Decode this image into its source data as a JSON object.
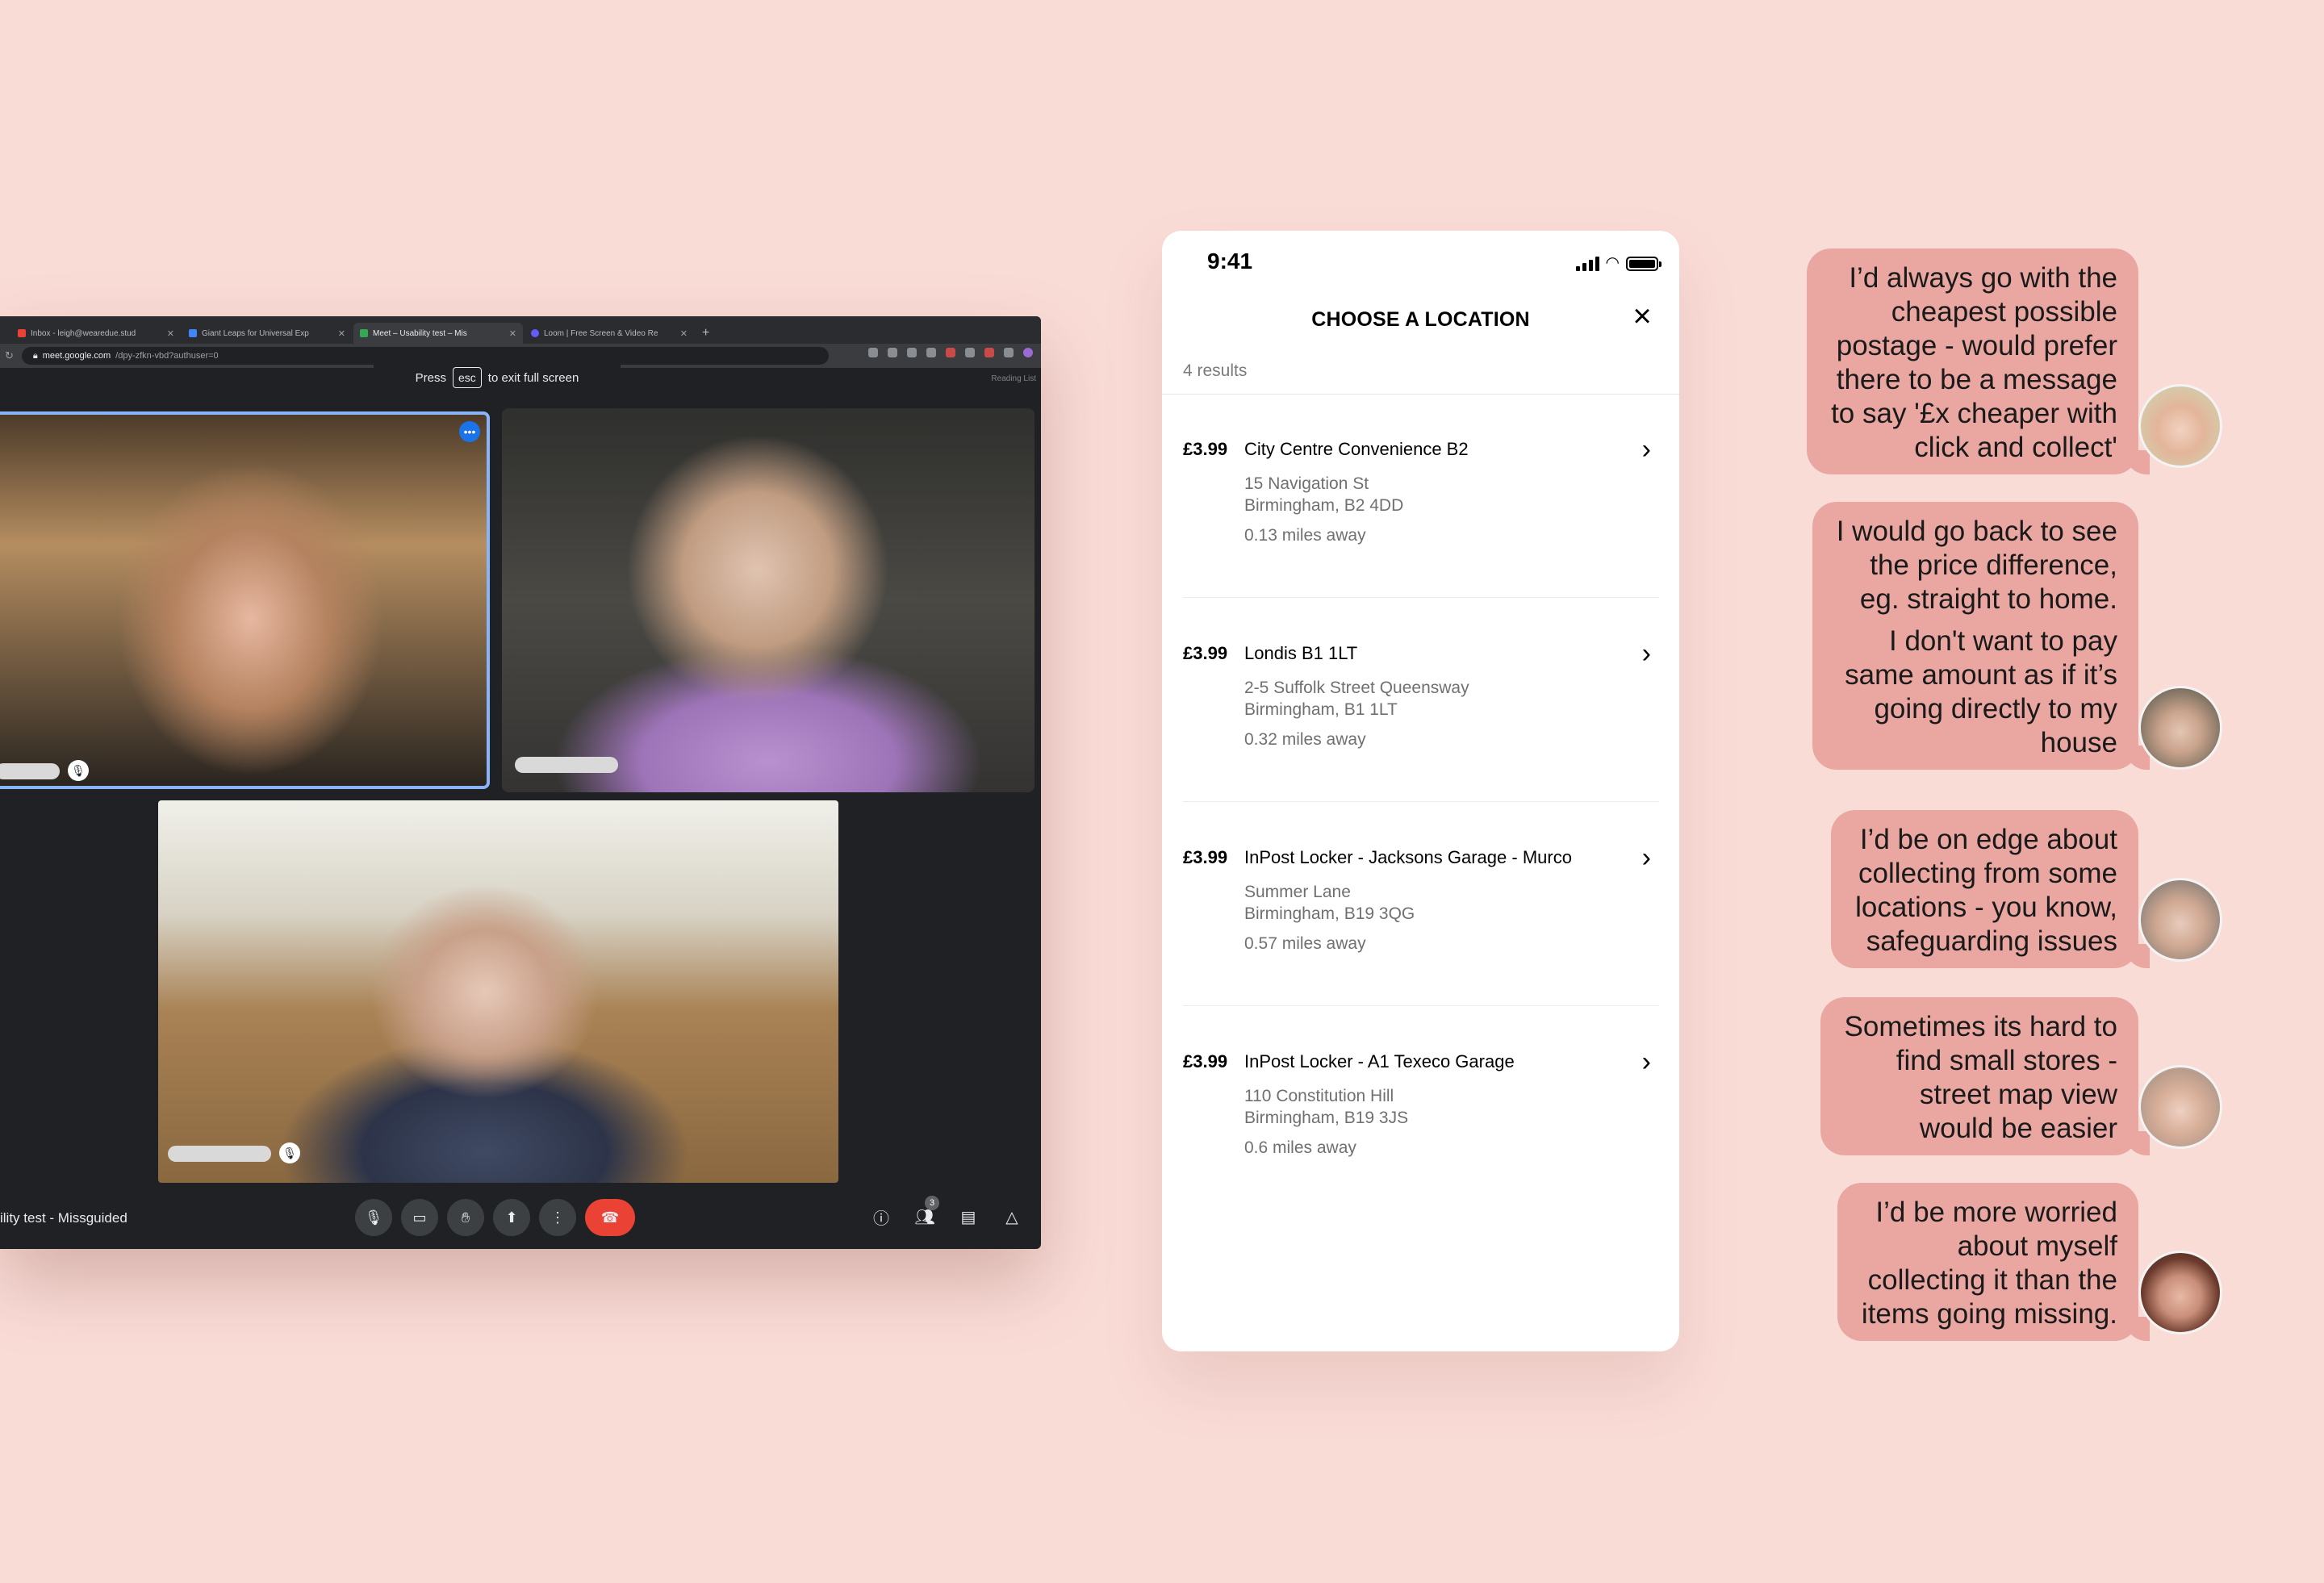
{
  "browser": {
    "tabs": [
      {
        "label": "Inbox - leigh@wearedue.stud",
        "color": "#ea4335"
      },
      {
        "label": "Giant Leaps for Universal Exp",
        "color": "#4285f4"
      },
      {
        "label": "Meet – Usability test – Mis",
        "color": "#34a853"
      },
      {
        "label": "Loom | Free Screen & Video Re",
        "color": "#625df5"
      }
    ],
    "url_host": "meet.google.com",
    "url_path": "/dpy-zfkn-vbd?authuser=0",
    "reading_list": "Reading List",
    "toast_press": "Press",
    "toast_key": "esc",
    "toast_text": "to exit full screen"
  },
  "meet": {
    "title": "ility test - Missguided",
    "participants_count": "3",
    "controls": [
      "mic-icon",
      "camera-icon",
      "raise-hand-icon",
      "present-icon",
      "more-icon",
      "end-call-icon"
    ],
    "right_controls": [
      "info-icon",
      "people-icon",
      "chat-icon",
      "activities-icon"
    ]
  },
  "phone": {
    "time": "9:41",
    "title": "CHOOSE A LOCATION",
    "results": "4 results",
    "locations": [
      {
        "price": "£3.99",
        "name": "City Centre Convenience B2",
        "street": "15 Navigation St",
        "city": "Birmingham, B2 4DD",
        "distance": "0.13 miles away"
      },
      {
        "price": "£3.99",
        "name": "Londis B1 1LT",
        "street": "2-5 Suffolk Street Queensway",
        "city": "Birmingham, B1 1LT",
        "distance": "0.32 miles away"
      },
      {
        "price": "£3.99",
        "name": "InPost Locker - Jacksons Garage - Murco",
        "street": "Summer Lane",
        "city": "Birmingham, B19 3QG",
        "distance": "0.57 miles away"
      },
      {
        "price": "£3.99",
        "name": "InPost Locker - A1 Texeco Garage",
        "street": "110 Constitution Hill",
        "city": "Birmingham, B19 3JS",
        "distance": "0.6 miles away"
      }
    ]
  },
  "quotes": [
    {
      "lines": [
        "I’d always go with the",
        "cheapest possible",
        "postage - would prefer",
        "there to be a message",
        "to say '£x cheaper with",
        "click and collect'"
      ]
    },
    {
      "lines": [
        "I would go back to see",
        "the price difference,",
        "eg. straight to home."
      ],
      "lines2": [
        "I don't want to pay",
        "same amount as if it’s",
        "going directly to my",
        "house"
      ]
    },
    {
      "lines": [
        "I’d be on edge about",
        "collecting from some",
        "locations - you know,",
        "safeguarding issues"
      ]
    },
    {
      "lines": [
        "Sometimes its hard to",
        "find small stores -",
        "street map view",
        "would be easier"
      ]
    },
    {
      "lines": [
        "I’d be more worried",
        "about myself",
        "collecting it than the",
        "items going missing."
      ]
    }
  ],
  "colors": {
    "background": "#fadcd7",
    "bubble": "#eaa7a1",
    "end_call": "#ea4335",
    "active_speaker": "#8ab4f8"
  }
}
